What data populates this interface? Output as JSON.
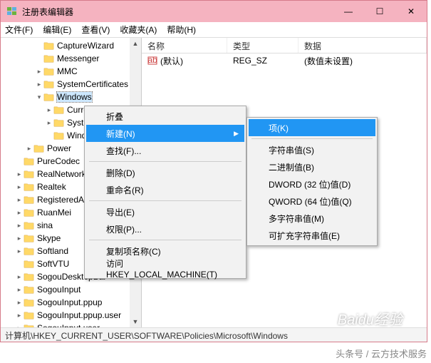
{
  "window": {
    "title": "注册表编辑器",
    "min": "—",
    "max": "☐",
    "close": "✕"
  },
  "menubar": [
    "文件(F)",
    "编辑(E)",
    "查看(V)",
    "收藏夹(A)",
    "帮助(H)"
  ],
  "tree": {
    "items": [
      {
        "indent": 3,
        "exp": "",
        "label": "CaptureWizard"
      },
      {
        "indent": 3,
        "exp": "",
        "label": "Messenger"
      },
      {
        "indent": 3,
        "exp": ">",
        "label": "MMC"
      },
      {
        "indent": 3,
        "exp": ">",
        "label": "SystemCertificates"
      },
      {
        "indent": 3,
        "exp": "v",
        "label": "Windows",
        "sel": true
      },
      {
        "indent": 4,
        "exp": ">",
        "label": "Curre"
      },
      {
        "indent": 4,
        "exp": ">",
        "label": "Syster"
      },
      {
        "indent": 4,
        "exp": "",
        "label": "Window"
      },
      {
        "indent": 2,
        "exp": ">",
        "label": "Power"
      },
      {
        "indent": 1,
        "exp": "",
        "label": "PureCodec"
      },
      {
        "indent": 1,
        "exp": ">",
        "label": "RealNetworks"
      },
      {
        "indent": 1,
        "exp": ">",
        "label": "Realtek"
      },
      {
        "indent": 1,
        "exp": ">",
        "label": "RegisteredAppl"
      },
      {
        "indent": 1,
        "exp": ">",
        "label": "RuanMei"
      },
      {
        "indent": 1,
        "exp": ">",
        "label": "sina"
      },
      {
        "indent": 1,
        "exp": ">",
        "label": "Skype"
      },
      {
        "indent": 1,
        "exp": ">",
        "label": "Softland"
      },
      {
        "indent": 1,
        "exp": "",
        "label": "SoftVTU"
      },
      {
        "indent": 1,
        "exp": ">",
        "label": "SogouDesktopBar"
      },
      {
        "indent": 1,
        "exp": ">",
        "label": "SogouInput"
      },
      {
        "indent": 1,
        "exp": ">",
        "label": "SogouInput.ppup"
      },
      {
        "indent": 1,
        "exp": ">",
        "label": "SogouInput.ppup.user"
      },
      {
        "indent": 1,
        "exp": ">",
        "label": "SogouInput.user"
      }
    ]
  },
  "list": {
    "cols": {
      "name": "名称",
      "type": "类型",
      "data": "数据"
    },
    "rows": [
      {
        "icon": "ab",
        "name": "(默认)",
        "type": "REG_SZ",
        "data": "(数值未设置)"
      }
    ]
  },
  "context_main": [
    {
      "label": "折叠"
    },
    {
      "label": "新建(N)",
      "hl": true,
      "arrow": true
    },
    {
      "label": "查找(F)..."
    },
    {
      "sep": true
    },
    {
      "label": "删除(D)"
    },
    {
      "label": "重命名(R)"
    },
    {
      "sep": true
    },
    {
      "label": "导出(E)"
    },
    {
      "label": "权限(P)..."
    },
    {
      "sep": true
    },
    {
      "label": "复制项名称(C)"
    },
    {
      "label": "访问 HKEY_LOCAL_MACHINE(T)"
    }
  ],
  "context_sub": [
    {
      "label": "项(K)",
      "hl": true
    },
    {
      "sep": true
    },
    {
      "label": "字符串值(S)"
    },
    {
      "label": "二进制值(B)"
    },
    {
      "label": "DWORD (32 位)值(D)"
    },
    {
      "label": "QWORD (64 位)值(Q)"
    },
    {
      "label": "多字符串值(M)"
    },
    {
      "label": "可扩充字符串值(E)"
    }
  ],
  "statusbar": "计算机\\HKEY_CURRENT_USER\\SOFTWARE\\Policies\\Microsoft\\Windows",
  "watermark": "Baidu经验",
  "footer": "头条号 / 云方技术服务"
}
